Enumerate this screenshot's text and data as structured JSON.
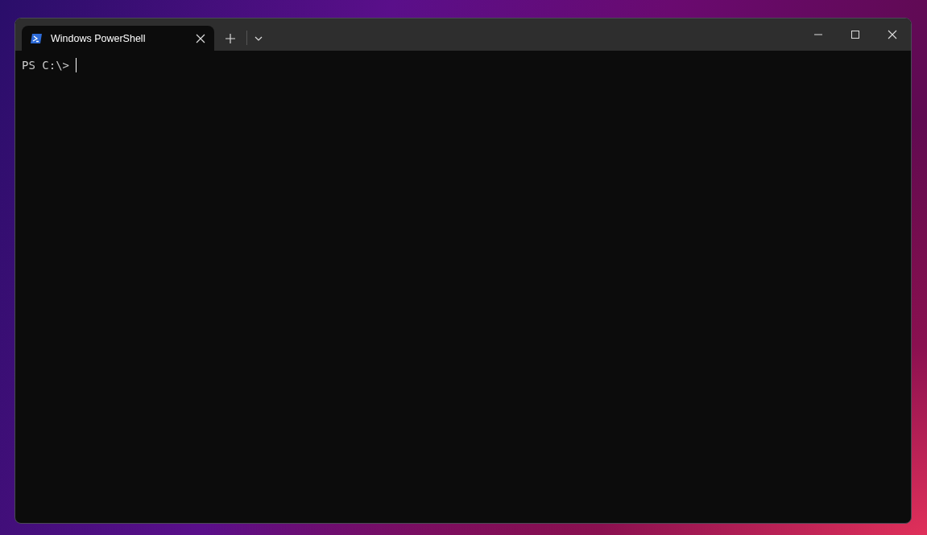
{
  "tabs": [
    {
      "title": "Windows PowerShell",
      "selected": true
    }
  ],
  "terminal": {
    "prompt": "PS C:\\>"
  }
}
